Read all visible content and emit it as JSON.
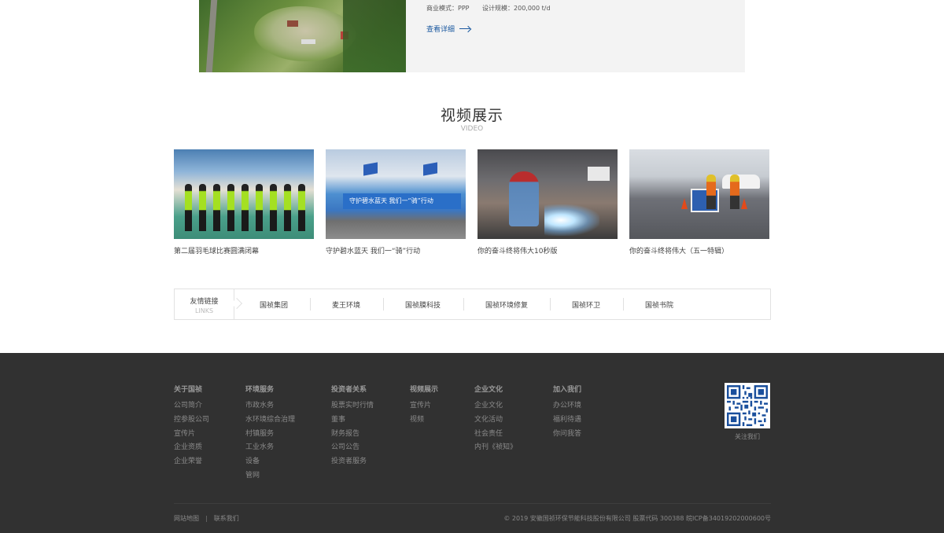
{
  "project": {
    "business_mode": "商业模式：PPP",
    "design_scale": "设计规模：200,000  t/d",
    "detail_link": "查看详细"
  },
  "video_section": {
    "title": "视频展示",
    "subtitle": "VIDEO",
    "items": [
      {
        "caption": "第二届羽毛球比赛圆满闭幕"
      },
      {
        "caption": "守护碧水蓝天 我们一“骑”行动"
      },
      {
        "caption": "你的奋斗终将伟大10秒版"
      },
      {
        "caption": "你的奋斗终将伟大（五一特辑）"
      }
    ],
    "banner_text": "守护碧水蓝天  我们一“骑”行动"
  },
  "links": {
    "label": "友情链接",
    "sublabel": "LINKS",
    "items": [
      "国祯集团",
      "麦王环境",
      "国祯膜科技",
      "国祯环境修复",
      "国祯环卫",
      "国祯书院"
    ]
  },
  "footer": {
    "columns": [
      {
        "head": "关于国祯",
        "items": [
          "公司简介",
          "控参股公司",
          "宣传片",
          "企业资质",
          "企业荣誉"
        ]
      },
      {
        "head": "环境服务",
        "items": [
          "市政水务",
          "水环境综合治理",
          "村镇服务",
          "工业水务",
          "设备",
          "管网"
        ]
      },
      {
        "head": "投资者关系",
        "items": [
          "股票实时行情",
          "董事",
          "财务报告",
          "公司公告",
          "投资者服务"
        ]
      },
      {
        "head": "视频展示",
        "items": [
          "宣传片",
          "视频"
        ]
      },
      {
        "head": "企业文化",
        "items": [
          "企业文化",
          "文化活动",
          "社会责任",
          "内刊《祯知》"
        ]
      },
      {
        "head": "加入我们",
        "items": [
          "办公环境",
          "福利待遇",
          "你问我答"
        ]
      }
    ],
    "qr_label": "关注我们",
    "bottom_links": [
      "网站地图",
      "联系我们"
    ],
    "copyright": "© 2019 安徽国祯环保节能科技股份有限公司 股票代码 300388 皖ICP备34019202000600号"
  }
}
